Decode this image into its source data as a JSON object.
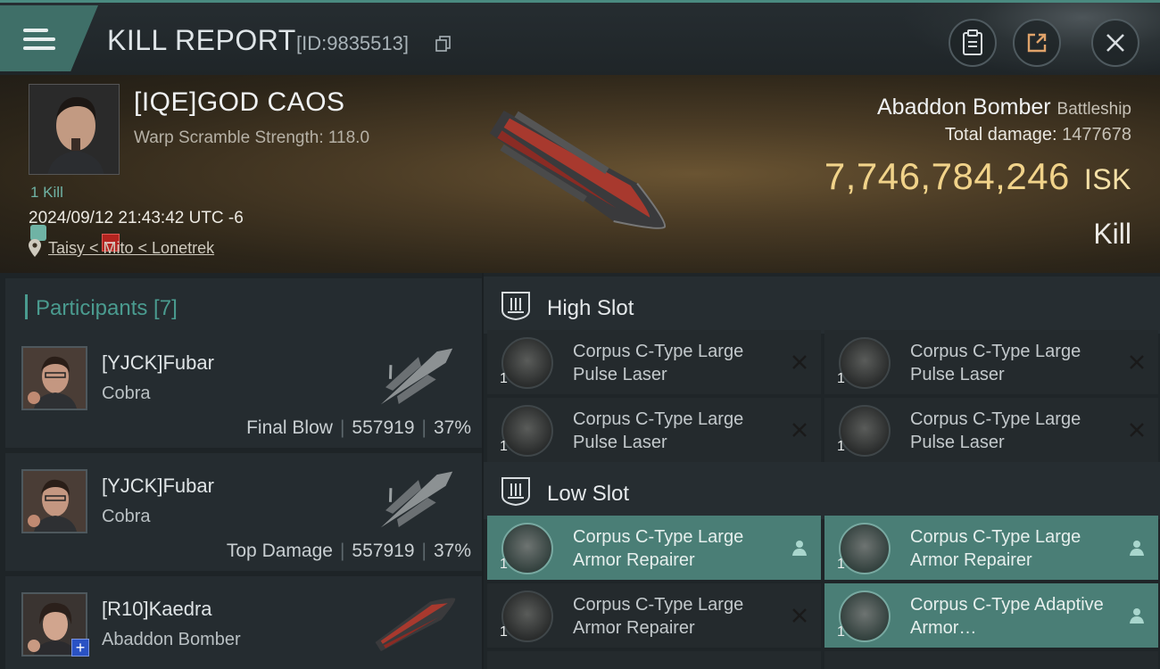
{
  "header": {
    "title": "KILL REPORT",
    "report_id": "[ID:9835513]",
    "buttons": [
      "clipboard-icon",
      "share-icon",
      "close-icon"
    ]
  },
  "victim": {
    "name": "[IQE]GOD CAOS",
    "warp_scramble": "Warp Scramble Strength: 118.0",
    "kills_label": "1 Kill",
    "datetime": "2024/09/12 21:43:42 UTC -6",
    "location": "Taisy < Mito < Lonetrek",
    "ship_name": "Abaddon Bomber",
    "ship_class": "Battleship",
    "total_damage_label": "Total damage:",
    "total_damage": "1477678",
    "isk_value": "7,746,784,246",
    "isk_unit": "ISK",
    "result": "Kill"
  },
  "participants": {
    "title": "Participants [7]",
    "rows": [
      {
        "name": "[YJCK]Fubar",
        "ship": "Cobra",
        "tag": "Final Blow",
        "damage": "557919",
        "percent": "37%"
      },
      {
        "name": "[YJCK]Fubar",
        "ship": "Cobra",
        "tag": "Top Damage",
        "damage": "557919",
        "percent": "37%"
      },
      {
        "name": "[R10]Kaedra",
        "ship": "Abaddon Bomber",
        "tag": "",
        "damage": "",
        "percent": ""
      }
    ]
  },
  "slots": {
    "high": {
      "title": "High Slot",
      "modules": [
        {
          "name": "Corpus C-Type Large Pulse Laser",
          "qty": "1",
          "status": "destroyed"
        },
        {
          "name": "Corpus C-Type Large Pulse Laser",
          "qty": "1",
          "status": "destroyed"
        },
        {
          "name": "Corpus C-Type Large Pulse Laser",
          "qty": "1",
          "status": "destroyed"
        },
        {
          "name": "Corpus C-Type Large Pulse Laser",
          "qty": "1",
          "status": "destroyed"
        }
      ]
    },
    "low": {
      "title": "Low Slot",
      "modules": [
        {
          "name": "Corpus C-Type Large Armor Repairer",
          "qty": "1",
          "status": "dropped"
        },
        {
          "name": "Corpus C-Type Large Armor Repairer",
          "qty": "1",
          "status": "dropped"
        },
        {
          "name": "Corpus C-Type Large Armor Repairer",
          "qty": "1",
          "status": "destroyed"
        },
        {
          "name": "Corpus C-Type Adaptive Armor…",
          "qty": "1",
          "status": "dropped"
        }
      ]
    }
  },
  "colors": {
    "accent": "#4a9b8f",
    "isk": "#f1d38a",
    "dropped": "#4a7e76",
    "destroyed": "#242a2d"
  }
}
